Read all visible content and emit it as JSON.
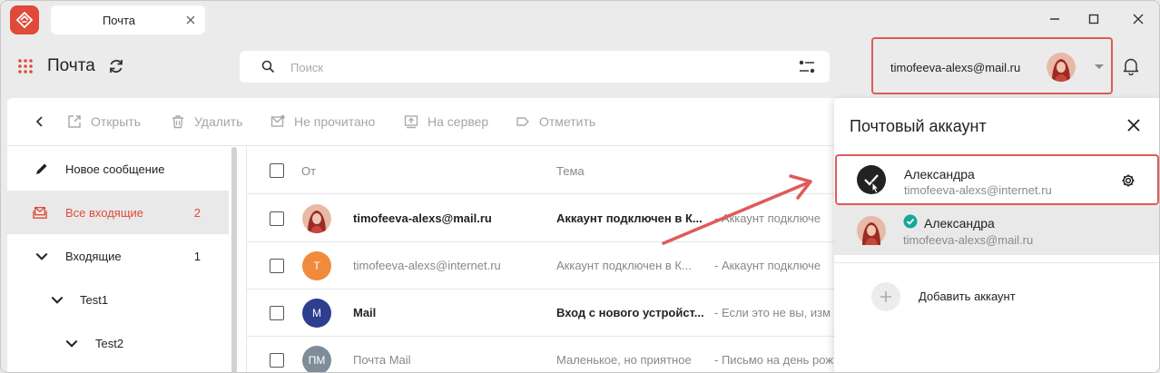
{
  "window": {
    "tab_title": "Почта"
  },
  "header": {
    "app_title": "Почта",
    "search_placeholder": "Поиск",
    "account_email": "timofeeva-alexs@mail.ru"
  },
  "toolbar": {
    "open": "Открыть",
    "delete": "Удалить",
    "unread": "Не прочитано",
    "to_server": "На сервер",
    "mark": "Отметить"
  },
  "sidebar": {
    "new_message": "Новое сообщение",
    "all_inbox": "Все входящие",
    "all_inbox_count": "2",
    "inbox": "Входящие",
    "inbox_count": "1",
    "folder1": "Test1",
    "folder2": "Test2"
  },
  "list": {
    "col_from": "От",
    "col_subject": "Тема",
    "rows": [
      {
        "from": "timofeeva-alexs@mail.ru",
        "subject": "Аккаунт подключен в К...",
        "preview": "- Аккаунт подключе",
        "avatar": "",
        "avatar_color": "#b0453e"
      },
      {
        "from": "timofeeva-alexs@internet.ru",
        "subject": "Аккаунт подключен в К...",
        "preview": "- Аккаунт подключе",
        "avatar": "Т",
        "avatar_color": "#f08a3c"
      },
      {
        "from": "Mail",
        "subject": "Вход с нового устройст...",
        "preview": "- Если это не вы, изм",
        "avatar": "M",
        "avatar_color": "#2f3f8f"
      },
      {
        "from": "Почта Mail",
        "subject": "Маленькое, но приятное",
        "preview": "- Письмо на день рож",
        "avatar": "ПМ",
        "avatar_color": "#7f8c99"
      }
    ]
  },
  "popup": {
    "title": "Почтовый аккаунт",
    "accounts": [
      {
        "name": "Александра",
        "email": "timofeeva-alexs@internet.ru"
      },
      {
        "name": "Александра",
        "email": "timofeeva-alexs@mail.ru"
      }
    ],
    "add_label": "Добавить аккаунт"
  },
  "colors": {
    "accent": "#e04a3a",
    "highlight": "#e05a5a",
    "verified": "#14a89a"
  }
}
